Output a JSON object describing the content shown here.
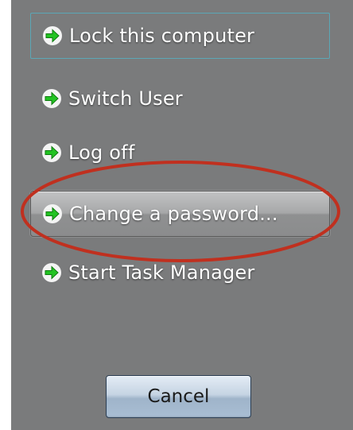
{
  "options": [
    {
      "label": "Lock this computer"
    },
    {
      "label": "Switch User"
    },
    {
      "label": "Log off"
    },
    {
      "label": "Change a password..."
    },
    {
      "label": "Start Task Manager"
    }
  ],
  "cancel_label": "Cancel",
  "icons": {
    "option_arrow": "green-right-arrow-icon"
  },
  "colors": {
    "panel_background": "#7a7b7c",
    "arrow_green": "#22c322",
    "highlight_ellipse": "#c0301f",
    "focus_border": "#5ba7b6"
  }
}
